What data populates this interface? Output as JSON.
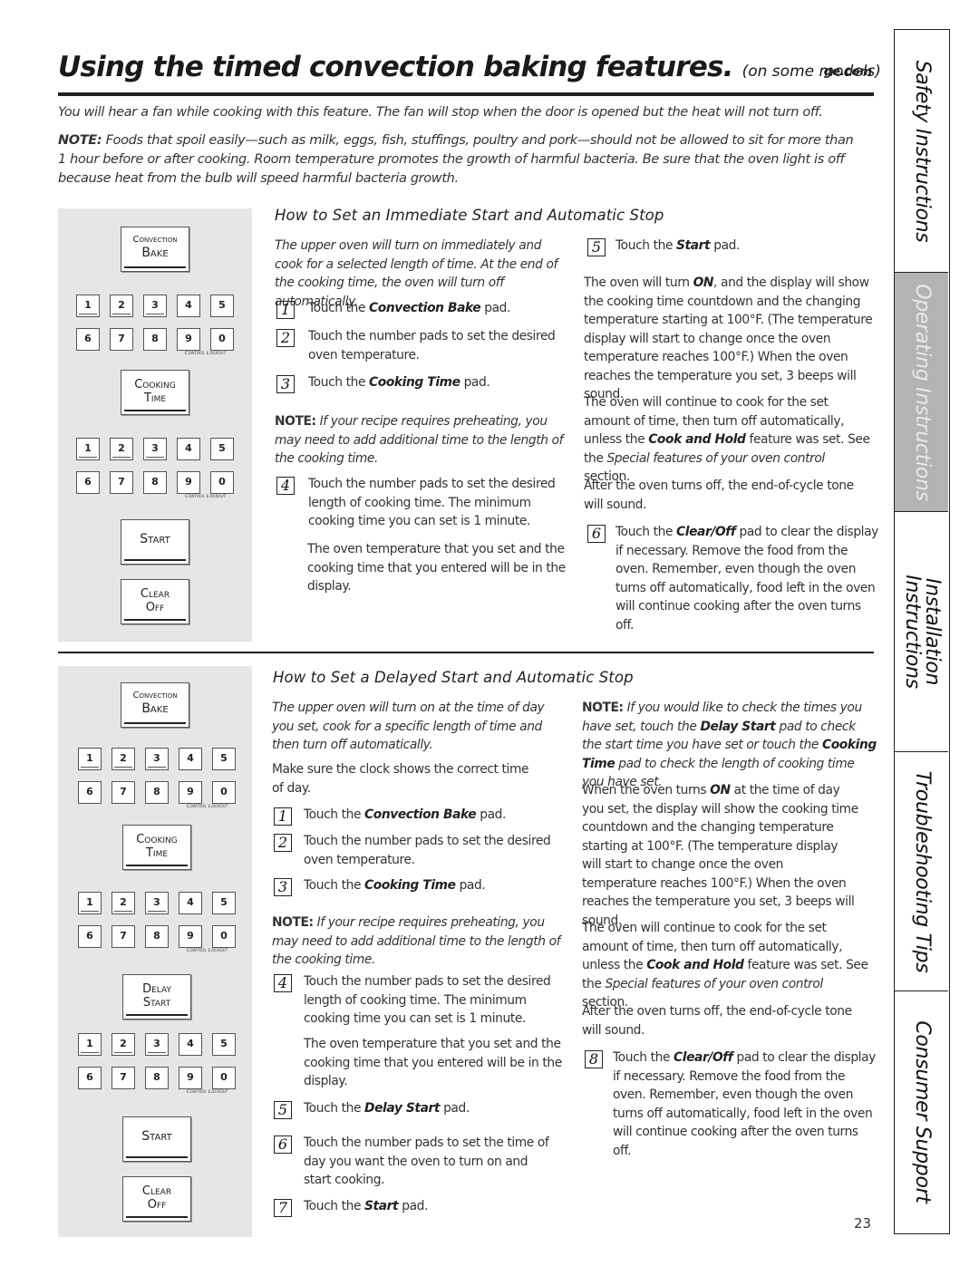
{
  "header": {
    "title": "Using the timed convection baking features.",
    "subtitle": "(on some models)",
    "site": "ge.com"
  },
  "intro": "You will hear a fan while cooking with this feature. The fan will stop when the door is opened but the heat will not turn off.",
  "note": {
    "label": "NOTE:",
    "text": " Foods that spoil easily—such as milk, eggs, fish, stuffings, poultry and pork—should not be allowed to sit for more than 1 hour before or after cooking. Room temperature promotes the growth of harmful bacteria. Be sure that the oven light is off because heat from the bulb will speed harmful bacteria growth."
  },
  "keypad": {
    "convection_bake": [
      "Convection",
      "Bake"
    ],
    "cooking_time": [
      "Cooking",
      "Time"
    ],
    "start": "Start",
    "clear_off": [
      "Clear",
      "Off"
    ],
    "delay_start": [
      "Delay",
      "Start"
    ],
    "digits_row1": [
      "1",
      "2",
      "3",
      "4",
      "5"
    ],
    "digits_row2": [
      "6",
      "7",
      "8",
      "9",
      "0"
    ],
    "lockout": "Control Lockout"
  },
  "section1": {
    "heading": "How to Set an Immediate Start and Automatic Stop",
    "intro": "The upper oven will turn on immediately and cook for a selected length of time. At the end of the cooking time, the oven will turn off automatically.",
    "steps": [
      {
        "num": "1",
        "pre": "Touch the ",
        "bold": "Convection Bake",
        "post": " pad."
      },
      {
        "num": "2",
        "pre": "Touch the number pads to set the desired oven temperature.",
        "bold": "",
        "post": ""
      },
      {
        "num": "3",
        "pre": "Touch the ",
        "bold": "Cooking Time",
        "post": " pad."
      },
      {
        "num": "4",
        "pre": "Touch the number pads to set the desired length of cooking time. The minimum cooking time you can set is 1 minute.",
        "bold": "",
        "post": ""
      },
      {
        "num": "5",
        "pre": "Touch the ",
        "bold": "Start",
        "post": " pad."
      },
      {
        "num": "6",
        "pre": "Touch the ",
        "bold": "Clear/Off",
        "post": " pad to clear the display if necessary. Remove the food from the oven. Remember, even though the oven turns off automatically, food left in the oven will continue cooking after the oven turns off."
      }
    ],
    "note_label": "NOTE:",
    "note_text": " If your recipe requires preheating, you may need to add additional time to the length of the cooking time.",
    "display_text": "The oven temperature that you set and the cooking time that you entered will be in the display.",
    "para_on_pre": "The oven will turn ",
    "para_on_bold": "ON",
    "para_on_post": ", and the display will show the cooking time countdown and the changing temperature starting at 100°F. (The temperature display will start to change once the oven temperature reaches 100°F.) When the oven reaches the temperature you set, 3 beeps will sound.",
    "para_continue_pre": "The oven will continue to cook for the set amount of time, then turn off automatically, unless the ",
    "para_continue_bold": "Cook and Hold",
    "para_continue_mid": " feature was set. See the ",
    "para_continue_it": "Special features of your oven control",
    "para_continue_post": " section.",
    "para_tone": "After the oven turns off, the end-of-cycle tone will sound."
  },
  "section2": {
    "heading": "How to Set a Delayed Start and Automatic Stop",
    "intro": "The upper oven will turn on at the time of day you set, cook for a specific length of time and then turn off automatically.",
    "clock": "Make sure the clock shows the correct time of day.",
    "steps": [
      {
        "num": "1",
        "pre": "Touch the ",
        "bold": "Convection Bake",
        "post": " pad."
      },
      {
        "num": "2",
        "pre": "Touch the number pads to set the desired oven temperature.",
        "bold": "",
        "post": ""
      },
      {
        "num": "3",
        "pre": "Touch the ",
        "bold": "Cooking Time",
        "post": " pad."
      },
      {
        "num": "4",
        "pre": "Touch the number pads to set the desired length of cooking time. The minimum cooking time you can set is 1 minute.",
        "bold": "",
        "post": ""
      },
      {
        "num": "5",
        "pre": "Touch the ",
        "bold": "Delay Start",
        "post": " pad."
      },
      {
        "num": "6",
        "pre": "Touch the number pads to set the time of day you want the oven to turn on and start cooking.",
        "bold": "",
        "post": ""
      },
      {
        "num": "7",
        "pre": "Touch the ",
        "bold": "Start",
        "post": " pad."
      },
      {
        "num": "8",
        "pre": "Touch the ",
        "bold": "Clear/Off",
        "post": " pad to clear the display if necessary. Remove the food from the oven. Remember, even though the oven turns off automatically, food left in the oven will continue cooking after the oven turns off."
      }
    ],
    "note_label": "NOTE:",
    "note_text": " If your recipe requires preheating, you may need to add additional time to the length of the cooking time.",
    "display_text": "The oven temperature that you set and the cooking time that you entered will be in the display.",
    "check_note_label": "NOTE:",
    "check_note_1": " If you would like to check the times you have set, touch the ",
    "check_note_b1": "Delay Start",
    "check_note_2": " pad to check the start time you have set or touch the ",
    "check_note_b2": "Cooking Time",
    "check_note_3": " pad to check the length of cooking time you have set.",
    "para_on_pre": "When the oven turns ",
    "para_on_bold": "ON",
    "para_on_post": " at the time of day you set, the display will show the cooking time countdown and the changing temperature starting at 100°F. (The temperature display will start to change once the oven temperature reaches 100°F.) When the oven reaches the temperature you set, 3 beeps will sound.",
    "para_continue_pre": "The oven will continue to cook for the set amount of time, then turn off automatically, unless the ",
    "para_continue_bold": "Cook and Hold",
    "para_continue_mid": " feature was set. See the ",
    "para_continue_it": "Special features of your oven control",
    "para_continue_post": " section.",
    "para_tone": "After the oven turns off, the end-of-cycle tone will sound."
  },
  "side_tabs": [
    {
      "label": "Safety Instructions",
      "active": false
    },
    {
      "label": "Operating Instructions",
      "active": true
    },
    {
      "label": "Installation Instructions",
      "active": false
    },
    {
      "label": "Troubleshooting Tips",
      "active": false
    },
    {
      "label": "Consumer Support",
      "active": false
    }
  ],
  "page_number": "23"
}
